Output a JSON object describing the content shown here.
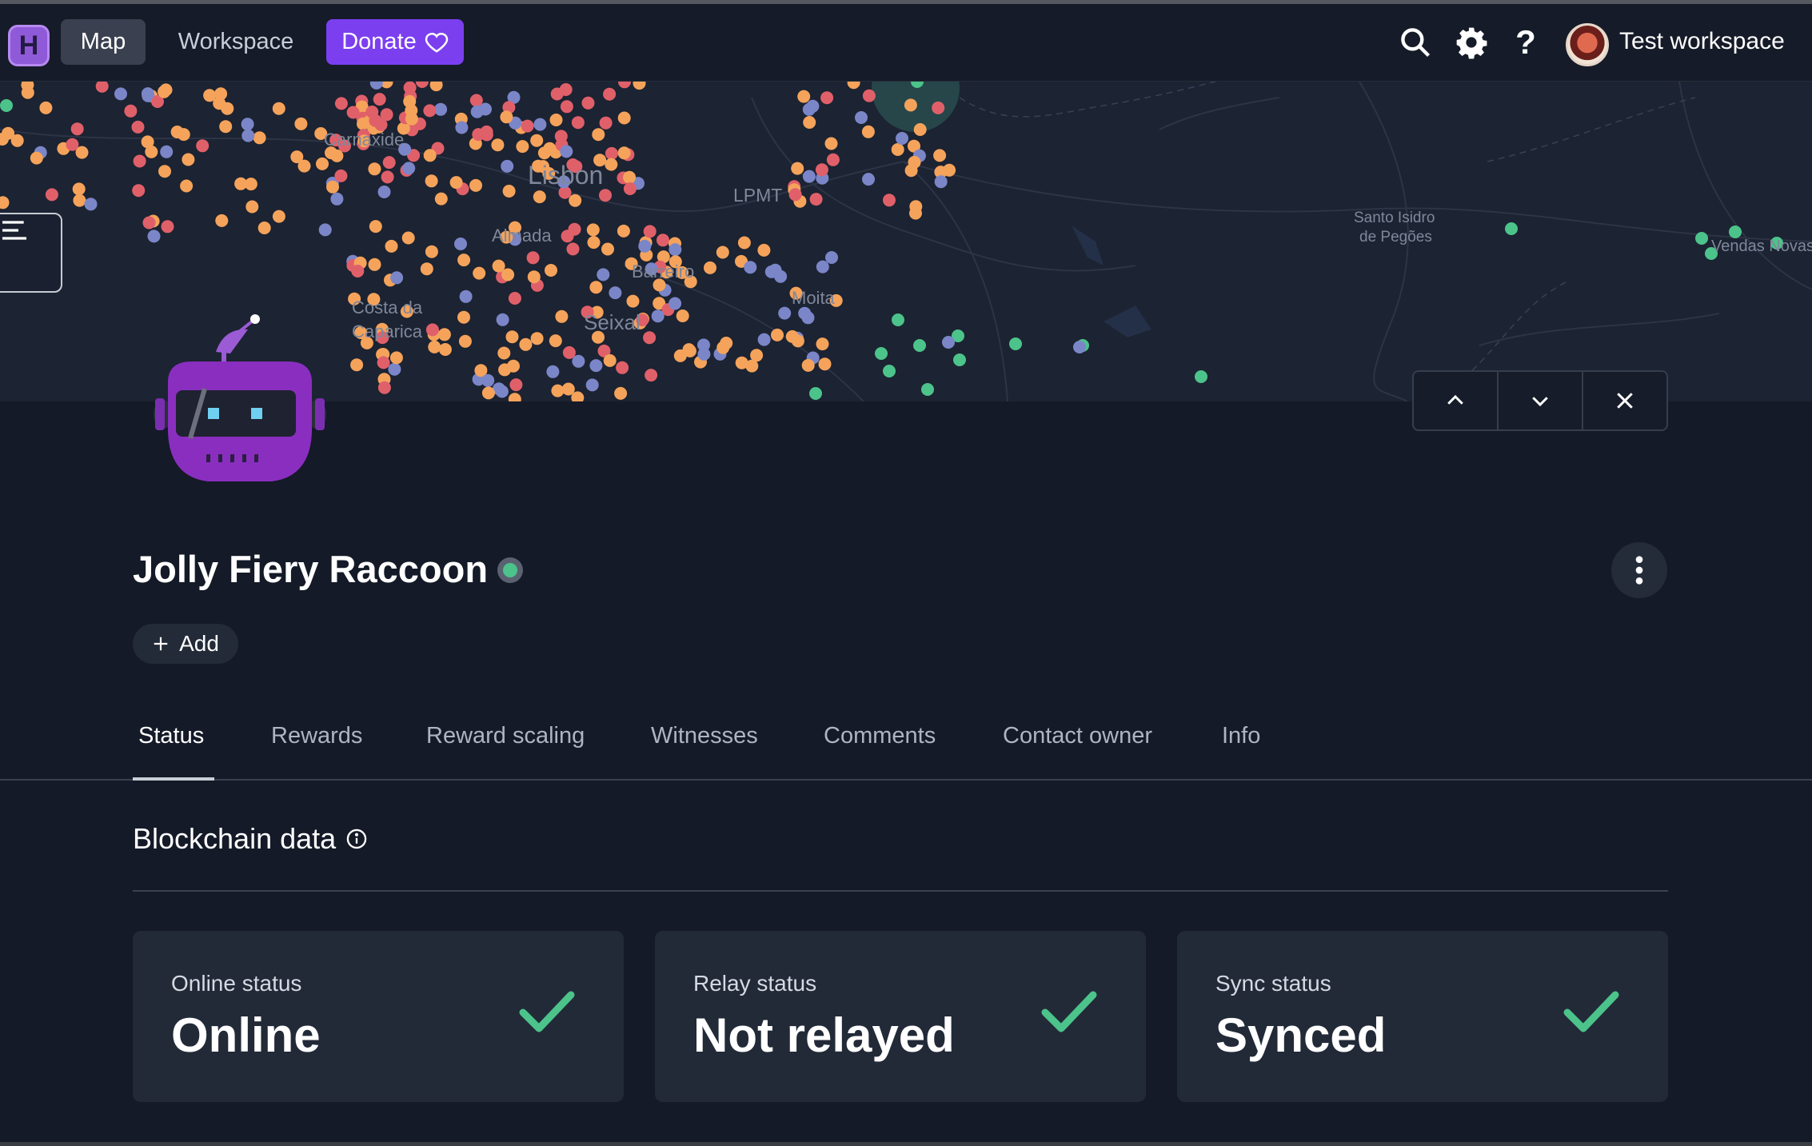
{
  "topbar": {
    "logo_letter": "H",
    "nav_map": "Map",
    "nav_workspace": "Workspace",
    "donate_label": "Donate",
    "search_icon": "search-icon",
    "settings_icon": "gear-icon",
    "help_label": "?",
    "workspace_name": "Test workspace"
  },
  "map": {
    "labels": {
      "lisbon": "Lisbon",
      "carnaxide": "Carnaxide",
      "almada": "Almada",
      "lpmt": "LPMT",
      "barreiro": "Barreiro",
      "moita": "Moita",
      "seixal": "Seixal",
      "costa": "Costa da",
      "caparica": "Caparica",
      "santo_isidro": "Santo Isidro",
      "pegoes": "de Pegões",
      "vendas_novas": "Vendas Novas"
    },
    "colors": {
      "orange": "#f5a35b",
      "red": "#e0606a",
      "blue": "#7b86c9",
      "green": "#4cc38a"
    }
  },
  "node": {
    "title": "Jolly Fiery Raccoon",
    "add_label": "Add"
  },
  "tabs": [
    "Status",
    "Rewards",
    "Reward scaling",
    "Witnesses",
    "Comments",
    "Contact owner",
    "Info"
  ],
  "section": {
    "title": "Blockchain data"
  },
  "cards": [
    {
      "label": "Online status",
      "value": "Online"
    },
    {
      "label": "Relay status",
      "value": "Not relayed"
    },
    {
      "label": "Sync status",
      "value": "Synced"
    }
  ],
  "accent": "#7b3ff0",
  "check_color": "#4cc38a"
}
